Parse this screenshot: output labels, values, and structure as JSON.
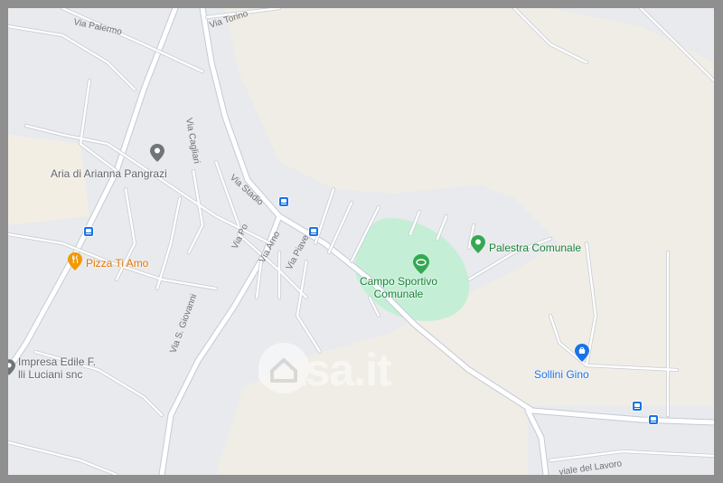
{
  "map": {
    "streets": {
      "via_palermo": "Via Palermo",
      "via_torino": "Via Torino",
      "via_cagliari": "Via Cagliari",
      "via_stadio": "Via Stadio",
      "via_po": "Via Po",
      "via_arno": "Via Arno",
      "via_piave": "Via Piave",
      "via_s_giovanni": "Via S. Giovanni",
      "viale_del_lavoro": "viale del Lavoro"
    },
    "pois": {
      "aria_di_arianna": "Aria di Arianna Pangrazi",
      "pizza_ti_amo": "Pizza Ti Amo",
      "palestra_comunale": "Palestra Comunale",
      "campo_sportivo_line1": "Campo Sportivo",
      "campo_sportivo_line2": "Comunale",
      "impresa_edile_line1": "Impresa Edile F.",
      "impresa_edile_line2": "lli Luciani snc",
      "sollini_gino": "Sollini Gino"
    },
    "watermark": "casa.it",
    "colors": {
      "land": "#f0ede6",
      "urban": "#e8eaed",
      "road": "#ffffff",
      "road_outline": "#c3cad6",
      "park": "#c4efd6",
      "green_poi": "#34a853",
      "orange_poi": "#f29900",
      "blue_poi": "#1a73e8",
      "gray_poi": "#70757a"
    }
  }
}
